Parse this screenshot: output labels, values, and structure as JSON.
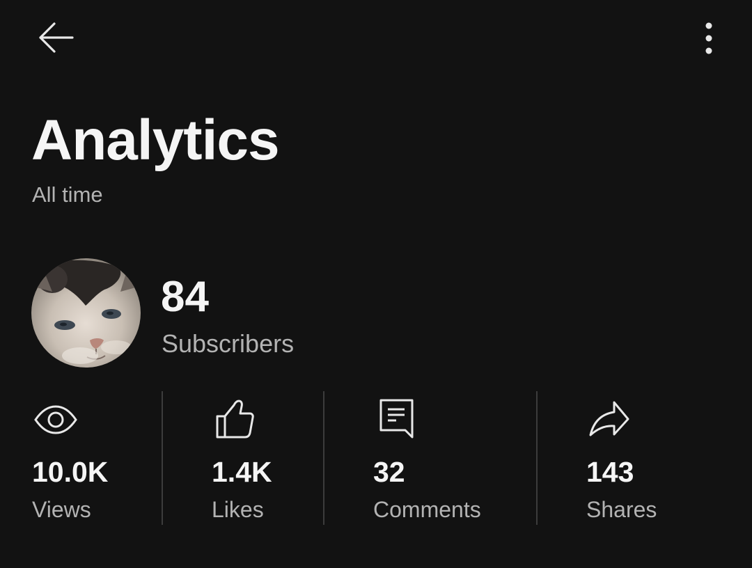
{
  "header": {
    "back_icon": "arrow-left-icon",
    "more_icon": "more-vertical-icon"
  },
  "page": {
    "title": "Analytics",
    "subtitle": "All time"
  },
  "channel": {
    "avatar": "kitten-avatar",
    "subscribers_count": "84",
    "subscribers_label": "Subscribers"
  },
  "stats": [
    {
      "icon": "eye-icon",
      "value": "10.0K",
      "label": "Views"
    },
    {
      "icon": "thumbs-up-icon",
      "value": "1.4K",
      "label": "Likes"
    },
    {
      "icon": "comment-icon",
      "value": "32",
      "label": "Comments"
    },
    {
      "icon": "share-icon",
      "value": "143",
      "label": "Shares"
    }
  ],
  "colors": {
    "background": "#121212",
    "primary_text": "#f5f5f5",
    "secondary_text": "#b3b3b3",
    "divider": "#3c3c3c"
  }
}
